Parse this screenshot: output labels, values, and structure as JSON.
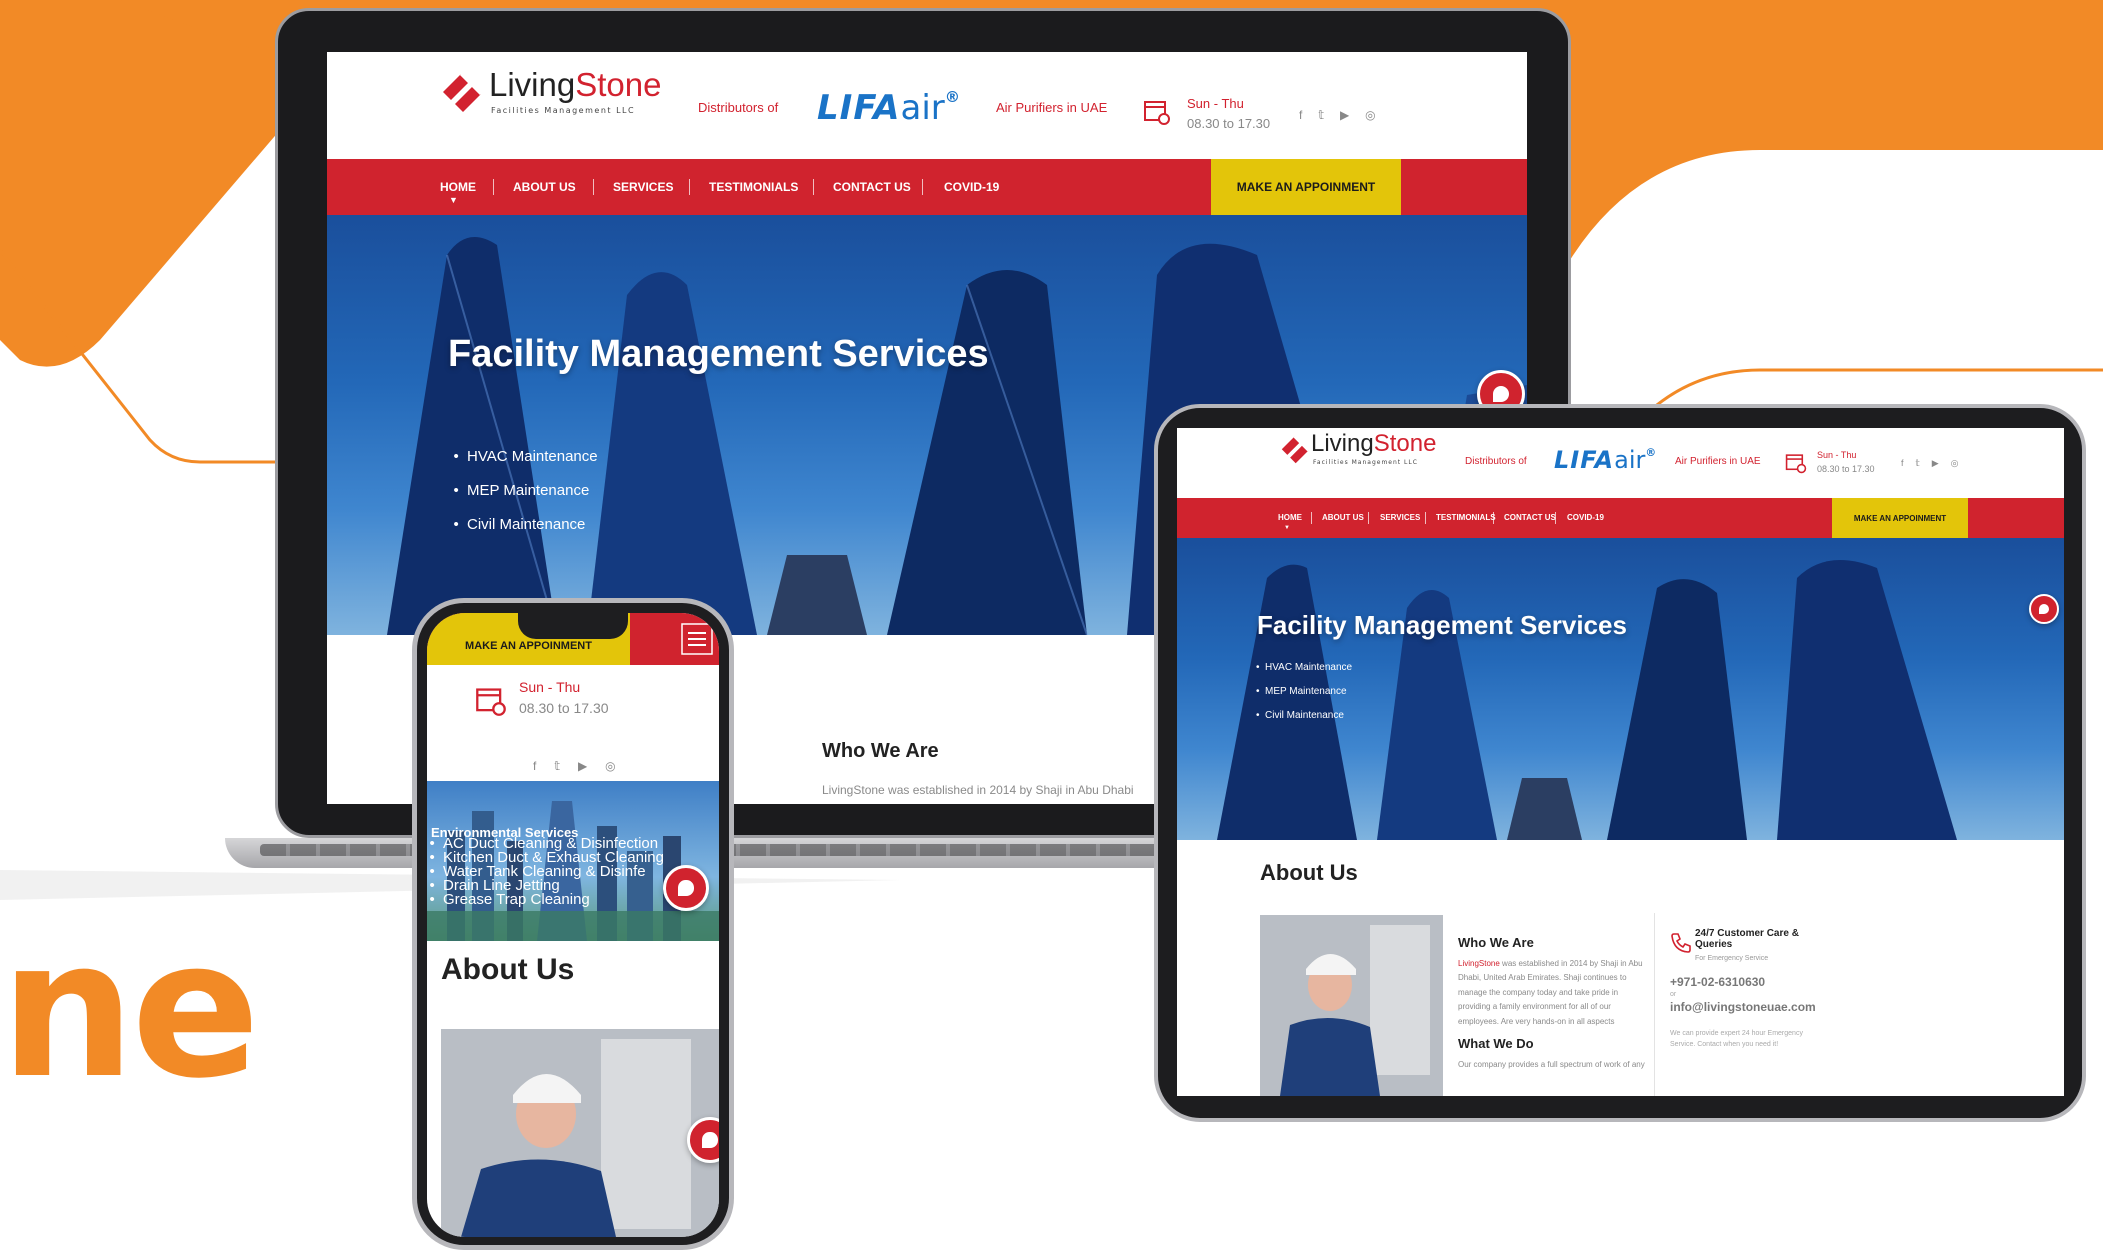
{
  "brand": {
    "logo_part1": "Living",
    "logo_part2": "Stone",
    "tagline": "Facilities Management LLC",
    "background_fragment": "ne",
    "orange": "#f28a26",
    "red": "#d0232e",
    "yellow": "#e3c50a",
    "blue": "#1a73c7"
  },
  "header": {
    "distributors_label": "Distributors of",
    "lifa_brand": "LIFA",
    "lifa_air": "air",
    "lifa_reg": "®",
    "purifiers_label": "Air Purifiers in UAE",
    "hours_days": "Sun - Thu",
    "hours_time": "08.30 to 17.30",
    "socials": [
      "f",
      "𝕥",
      "▶",
      "◎"
    ],
    "social_icons": [
      "facebook-icon",
      "twitter-icon",
      "youtube-icon",
      "instagram-icon"
    ]
  },
  "nav": {
    "items": [
      "HOME",
      "ABOUT US",
      "SERVICES",
      "TESTIMONIALS",
      "CONTACT US",
      "COVID-19"
    ],
    "cta": "MAKE AN APPOINMENT"
  },
  "hero": {
    "title": "Facility Management Services",
    "items": [
      "HVAC Maintenance",
      "MEP Maintenance",
      "Civil Maintenance"
    ]
  },
  "phone_hero": {
    "title": "Environmental Services",
    "items": [
      "AC Duct Cleaning & Disinfection",
      "Kitchen Duct & Exhaust Cleaning",
      "Water Tank Cleaning & Disinfe",
      "Drain Line Jetting",
      "Grease Trap Cleaning"
    ]
  },
  "about": {
    "title": "About Us",
    "who_title": "Who We Are",
    "who_brand": "LivingStone",
    "who_text": " was established in 2014 by Shaji in Abu Dhabi, United Arab Emirates. Shaji continues to manage the company today and take pride in providing a family environment for all of our employees. Are very hands-on in all aspects",
    "laptop_who_text": "LivingStone was established in 2014 by Shaji in Abu Dhabi",
    "what_title": "What We Do",
    "what_text": "Our company provides a full spectrum of work of any"
  },
  "care": {
    "title": "24/7 Customer Care & Queries",
    "subtitle": "For Emergency Service",
    "phone": "+971-02-6310630",
    "or": "or",
    "email": "info@livingstoneuae.com",
    "note": "We can provide expert 24 hour Emergency Service. Contact when you need it!"
  }
}
